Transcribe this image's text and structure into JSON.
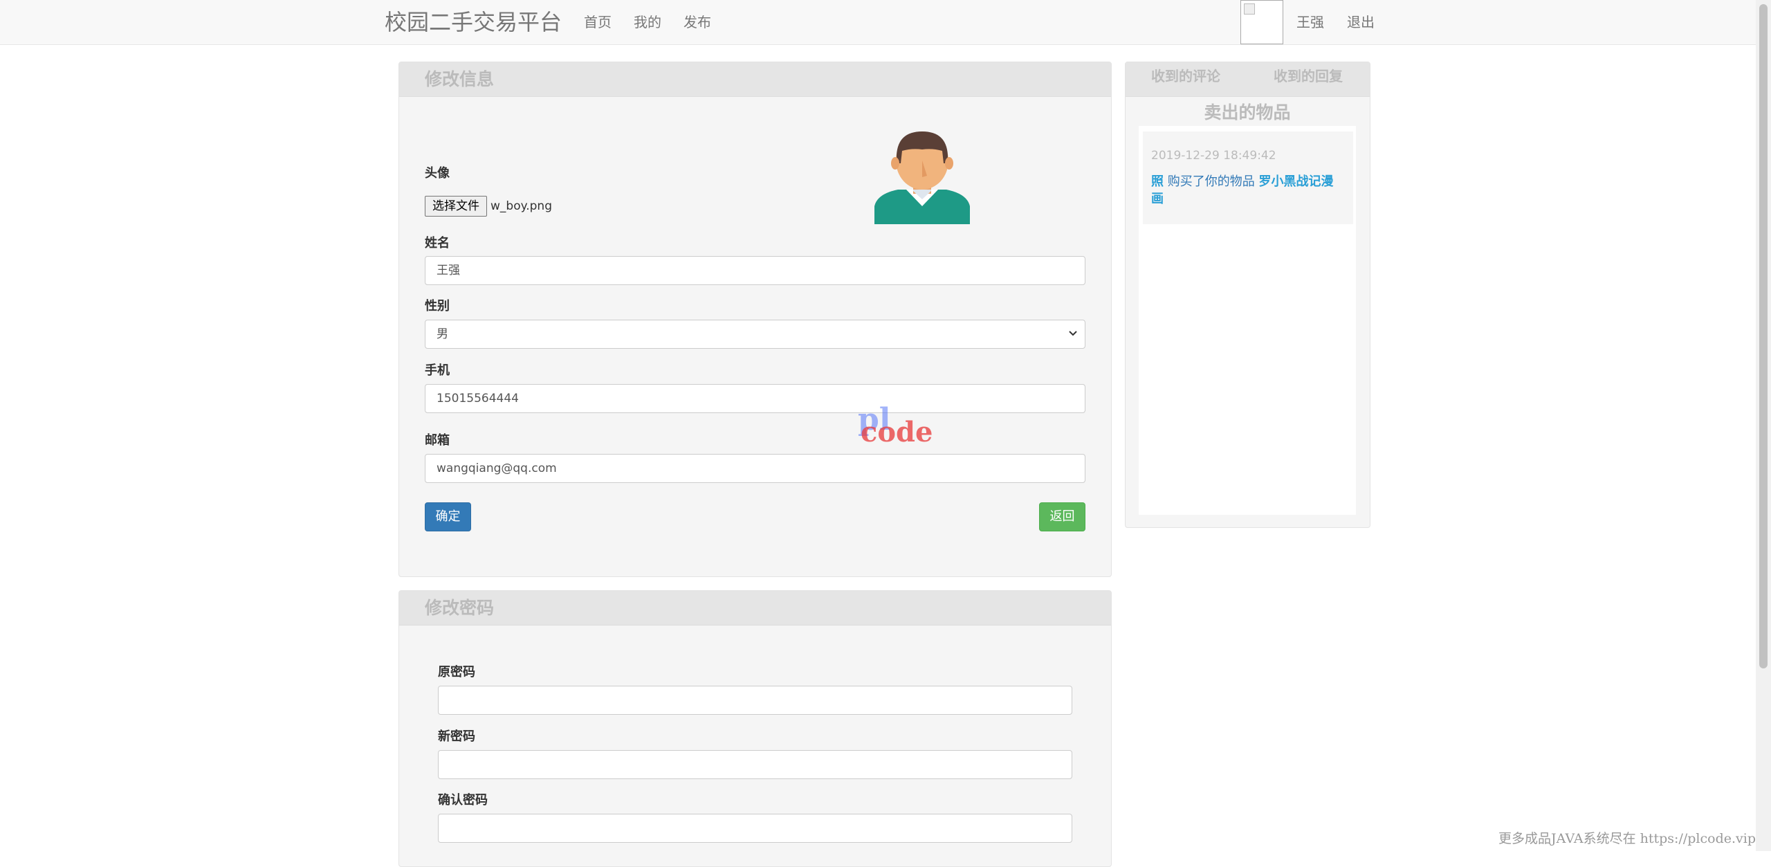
{
  "navbar": {
    "brand": "校园二手交易平台",
    "links": [
      "首页",
      "我的",
      "发布"
    ],
    "user_name": "王强",
    "logout": "退出"
  },
  "edit_info": {
    "title": "修改信息",
    "avatar_label": "头像",
    "file_button": "选择文件",
    "file_name": "w_boy.png",
    "name_label": "姓名",
    "name_value": "王强",
    "gender_label": "性别",
    "gender_value": "男",
    "phone_label": "手机",
    "phone_value": "15015564444",
    "email_label": "邮箱",
    "email_value": "wangqiang@qq.com",
    "confirm_button": "确定",
    "back_button": "返回"
  },
  "change_password": {
    "title": "修改密码",
    "old_label": "原密码",
    "new_label": "新密码",
    "confirm_label": "确认密码"
  },
  "sidebar": {
    "tabs": [
      "收到的评论",
      "收到的回复"
    ],
    "sold_title": "卖出的物品",
    "sold_items": [
      {
        "time": "2019-12-29 18:49:42",
        "buyer": "照",
        "action": "购买了你的物品",
        "item": "罗小黑战记漫画"
      }
    ]
  },
  "watermark": {
    "line1": "pl",
    "line2": "code"
  },
  "footer_note": "更多成品JAVA系统尽在 https://plcode.vip",
  "colors": {
    "primary": "#337ab7",
    "success": "#5cb85c",
    "panel_heading": "#e5e5e5",
    "muted_title": "#bbbbbb"
  }
}
